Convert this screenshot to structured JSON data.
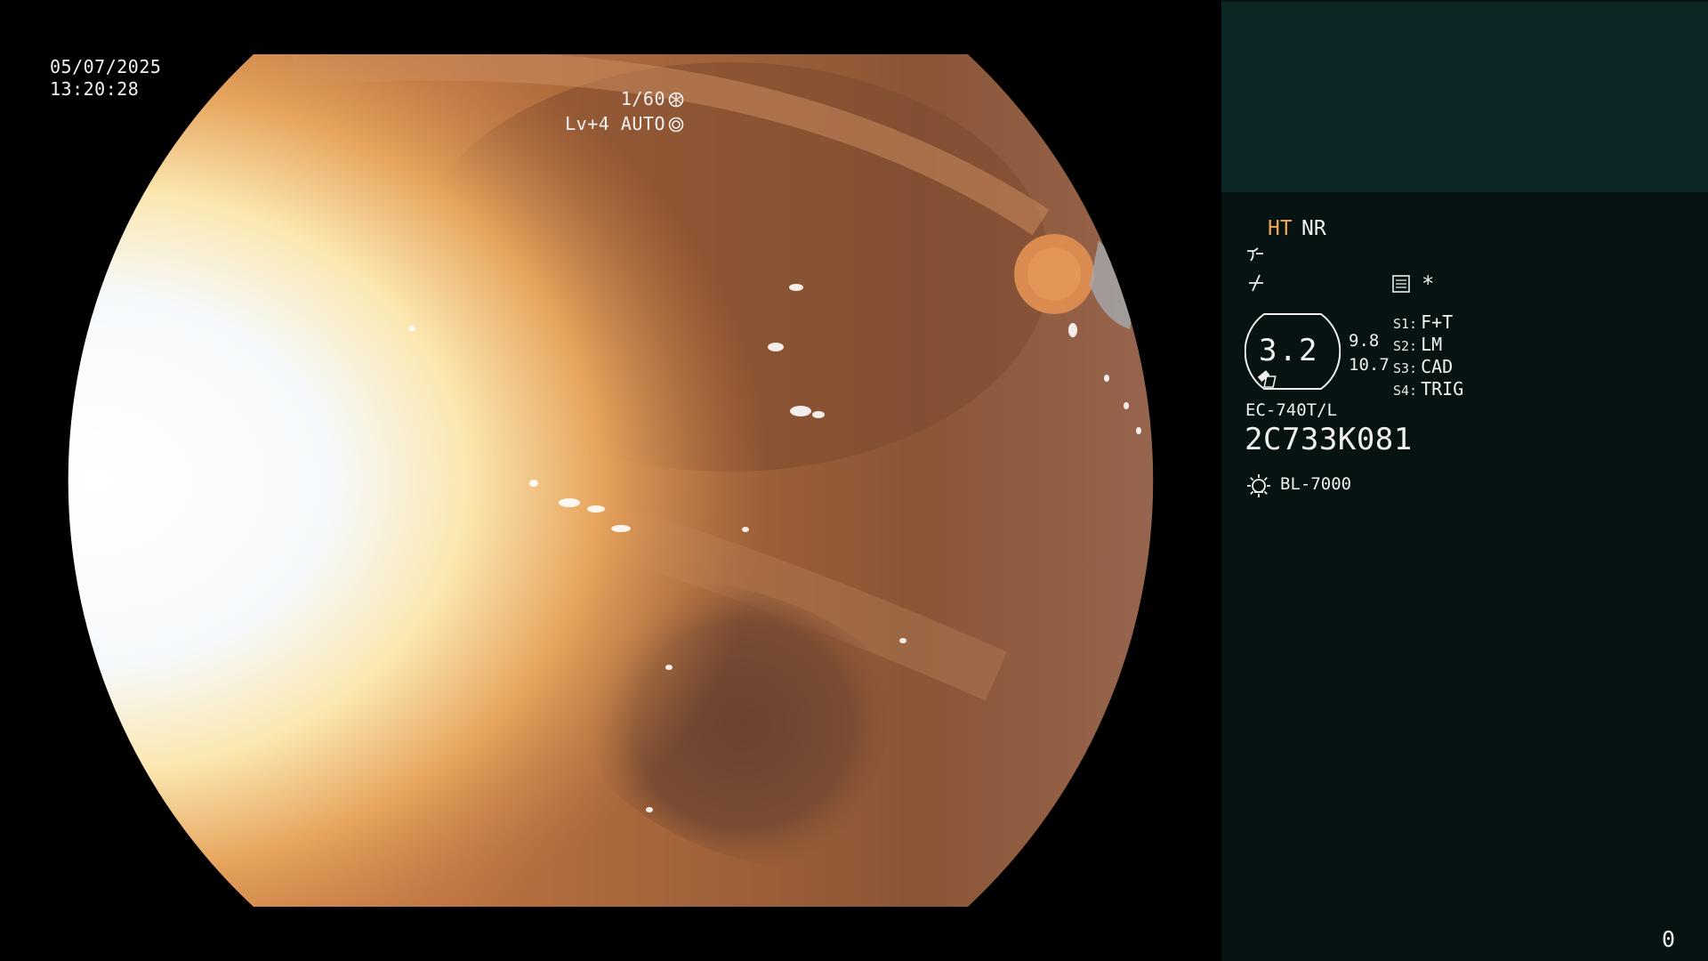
{
  "overlay": {
    "date": "05/07/2025",
    "time": "13:20:28",
    "shutter": "1/60",
    "shutter_icon": "shutter-icon",
    "iris_level": "Lv+4 AUTO",
    "iris_icon": "iris-icon"
  },
  "panel": {
    "mode_ht": "HT",
    "mode_nr": "NR",
    "enhance_icon_a": "structure-enhance-icon",
    "enhance_icon_b": "color-enhance-icon",
    "memo_icon": "memo-icon",
    "asterisk": "*",
    "zoom_value": "3.2",
    "scale_top": "9.8",
    "scale_bottom": "10.7",
    "switches": [
      {
        "key": "S1:",
        "value": "F+T"
      },
      {
        "key": "S2:",
        "value": "LM"
      },
      {
        "key": "S3:",
        "value": "CAD"
      },
      {
        "key": "S4:",
        "value": "TRIG"
      }
    ],
    "scope_model": "EC-740T/L",
    "scope_serial": "2C733K081",
    "light_icon": "light-source-icon",
    "light_source": "BL-7000",
    "frame_counter": "0"
  },
  "colors": {
    "panel_background": "#071313",
    "thumbnail_background": "#0c2525",
    "ht_accent": "#f5a84a",
    "tissue_orange": "#c4753d",
    "tissue_brown": "#7a4a2e"
  }
}
